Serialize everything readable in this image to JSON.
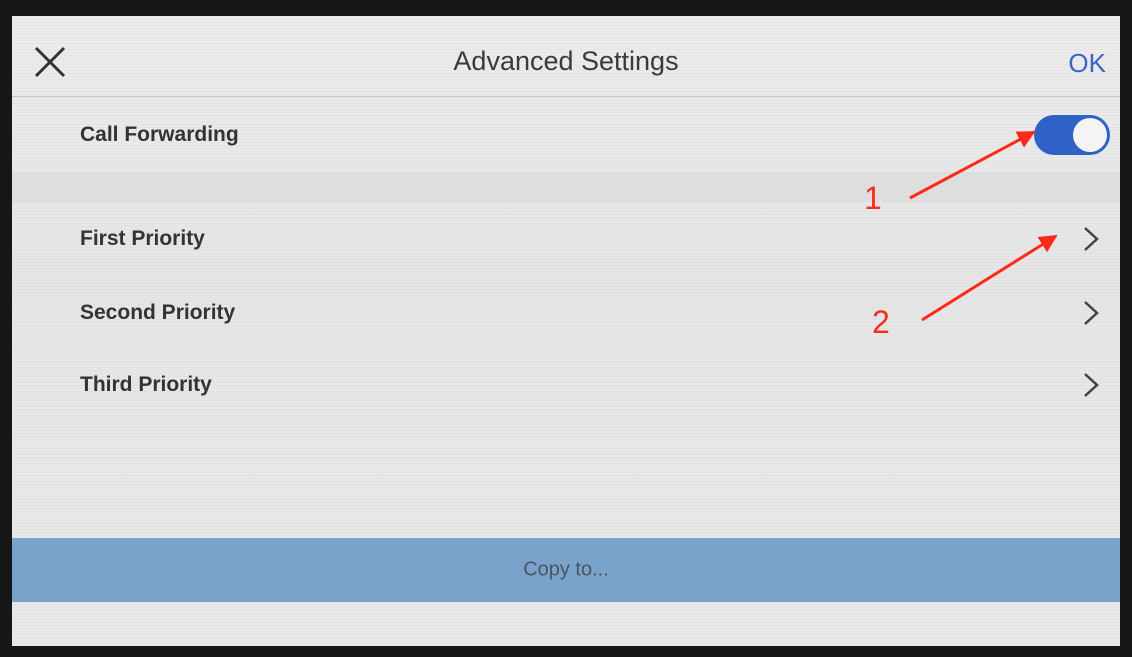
{
  "header": {
    "title": "Advanced Settings",
    "ok_label": "OK",
    "close_icon": "close-icon"
  },
  "call_forwarding": {
    "label": "Call Forwarding",
    "enabled": true
  },
  "priorities": [
    {
      "label": "First Priority"
    },
    {
      "label": "Second Priority"
    },
    {
      "label": "Third Priority"
    }
  ],
  "footer": {
    "copy_label": "Copy to..."
  },
  "annotations": {
    "one": "1",
    "two": "2"
  },
  "colors": {
    "accent": "#2f62c6",
    "copy_bar": "#7aa3cc",
    "annotation": "#ff2a1a"
  }
}
